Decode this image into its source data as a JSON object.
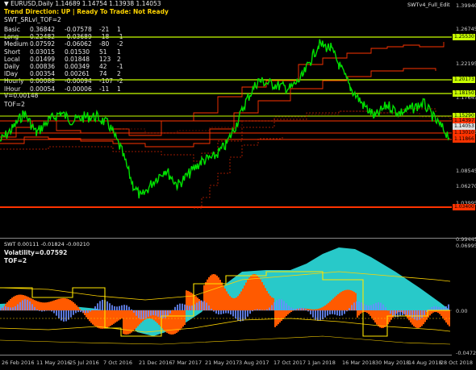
{
  "header": {
    "symbol_line": "▼ EURUSD,Daily  1.14689 1.14754 1.13938 1.14053",
    "trend_line": "Trend Direction:  UP   |  Ready To Trade:  Not Ready",
    "indicator_name": "SWT_SRLvl_TOF=2",
    "top_right_label": "SWTv4_Full_Edit"
  },
  "stats_table": [
    {
      "name": "Basic",
      "a": "0.36842",
      "b": "-0.07578",
      "c": "-21",
      "d": "1"
    },
    {
      "name": "Long",
      "a": "0.22482",
      "b": "-0.03689",
      "c": "-18",
      "d": "-1"
    },
    {
      "name": "Medium",
      "a": "0.07592",
      "b": "-0.06062",
      "c": "-80",
      "d": "-2"
    },
    {
      "name": "Short",
      "a": "0.03015",
      "b": "0.01530",
      "c": "51",
      "d": "1"
    },
    {
      "name": "Local",
      "a": "0.01499",
      "b": "0.01848",
      "c": "123",
      "d": "2"
    },
    {
      "name": "Daily",
      "a": "0.00836",
      "b": "0.00349",
      "c": "42",
      "d": "-1"
    },
    {
      "name": "IDay",
      "a": "0.00354",
      "b": "0.00261",
      "c": "74",
      "d": "2"
    },
    {
      "name": "Hourly",
      "a": "0.00088",
      "b": "-0.00094",
      "c": "-107",
      "d": "-2"
    },
    {
      "name": "IHour",
      "a": "0.00054",
      "b": "-0.00006",
      "c": "-11",
      "d": "1"
    }
  ],
  "v_line": "V=0.00148",
  "tof_line": "TOF=2",
  "price_axis": [
    "1.39940",
    "1.26745",
    "1.22195",
    "1.17645",
    "1.13095",
    "1.08545",
    "1.06270",
    "1.03995",
    "0.99445"
  ],
  "price_tags": [
    {
      "value": "1.25530",
      "color": "#c8ff00"
    },
    {
      "value": "1.20173",
      "color": "#c8ff00"
    },
    {
      "value": "1.18150",
      "color": "#c8ff00"
    },
    {
      "value": "1.15290",
      "color": "#c8ff00"
    },
    {
      "value": "1.14397",
      "color": "#ff3300"
    },
    {
      "value": "1.14053",
      "color": "#dddddd"
    },
    {
      "value": "1.13010",
      "color": "#ff3300"
    },
    {
      "value": "1.11866",
      "color": "#ff3300"
    },
    {
      "value": "1.03400",
      "color": "#ff3300"
    }
  ],
  "oscillator": {
    "title": "SWT 0.00111 -0.01824 -0.00210",
    "volatility": "Volatility=0.07592",
    "tof": "TOF=2",
    "axis": [
      "0.06995",
      "0.00",
      "-0.04723"
    ]
  },
  "date_axis": [
    "26 Feb 2016",
    "11 May 2016",
    "25 Jul 2016",
    "7 Oct 2016",
    "21 Dec 2016",
    "7 Mar 2017",
    "21 May 2017",
    "3 Aug 2017",
    "17 Oct 2017",
    "1 Jan 2018",
    "16 Mar 2018",
    "30 May 2018",
    "14 Aug 2018",
    "28 Oct 2018"
  ],
  "colors": {
    "price": "#00e000",
    "support": "#c8ff00",
    "resistance": "#ff3300",
    "osc_orange": "#ff5a00",
    "osc_cyan": "#2ad4d4",
    "osc_blue": "#6a8cff"
  }
}
